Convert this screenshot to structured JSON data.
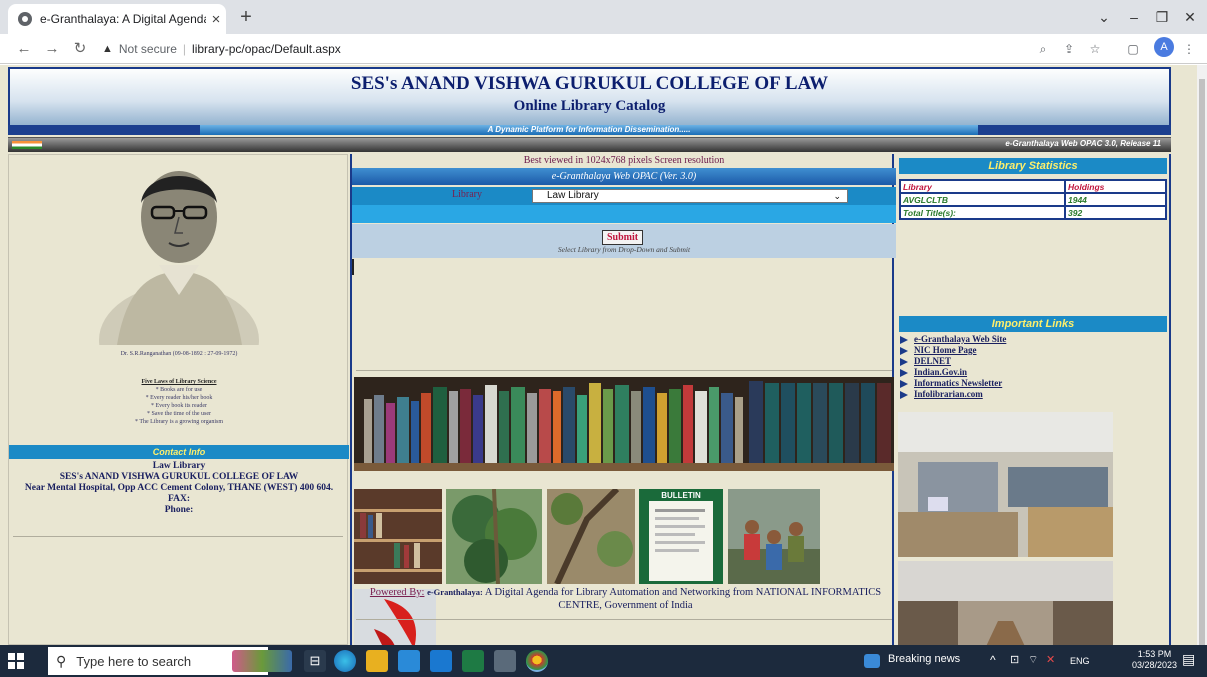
{
  "browser": {
    "tab_title": "e-Granthalaya: A Digital Agenda",
    "new_tab": "+",
    "close_tab": "×",
    "security": "Not secure",
    "url": "library-pc/opac/Default.aspx",
    "profile_initial": "A"
  },
  "header": {
    "title": "SES's ANAND VISHWA GURUKUL COLLEGE OF LAW",
    "subtitle": "Online Library Catalog",
    "tagline": "A Dynamic Platform for Information Dissemination.....",
    "version": "e-Granthalaya Web OPAC 3.0, Release 11"
  },
  "left": {
    "caption": "Dr. S.R.Ranganathan (09-08-1892 : 27-09-1972)",
    "laws_title": "Five Laws of Library Science",
    "laws": [
      "* Books are for use",
      "* Every reader his/her book",
      "* Every book its reader",
      "* Save the time of the user",
      "* The Library is a growing organism"
    ],
    "contact_header": "Contact Info",
    "contact_lines": [
      "Law Library",
      "SES's ANAND VISHWA GURUKUL COLLEGE OF LAW",
      "Near Mental Hospital, Opp ACC Cement Colony, THANE (WEST) 400 604.",
      "FAX:",
      "Phone:"
    ]
  },
  "middle": {
    "best_viewed": "Best viewed in 1024x768 pixels Screen resolution",
    "opac_header": "e-Granthalaya Web OPAC (Ver. 3.0)",
    "library_label": "Library",
    "library_selected": "Law Library",
    "submit_label": "Submit",
    "hint": "Select Library from Drop-Down and Submit",
    "powered_label": "Powered By:",
    "powered_brand": "e-Granthalaya:",
    "powered_text": "A Digital Agenda for Library Automation and Networking from NATIONAL INFORMATICS CENTRE, Government of India",
    "bulletin_label": "BULLETIN"
  },
  "right": {
    "stats_header": "Library Statistics",
    "stats_cols": [
      "Library",
      "Holdings"
    ],
    "stats_rows": [
      {
        "label": "AVGLCLTB",
        "value": "1944"
      },
      {
        "label": "Total Title(s):",
        "value": "392"
      }
    ],
    "links_header": "Important Links",
    "links": [
      "e-Granthalaya Web Site",
      "NIC Home Page",
      "DELNET",
      "Indian.Gov.in",
      "Informatics Newsletter",
      "Infolibrarian.com"
    ]
  },
  "taskbar": {
    "search_placeholder": "Type here to search",
    "news": "Breaking news",
    "lang": "ENG",
    "time": "1:53 PM",
    "date": "03/28/2023"
  }
}
